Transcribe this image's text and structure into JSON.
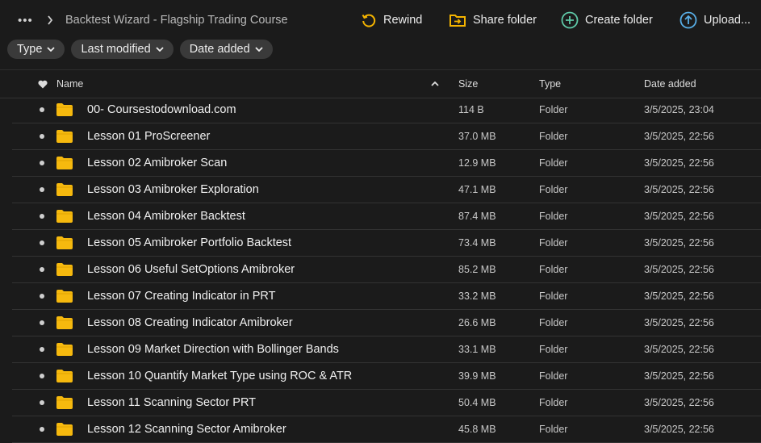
{
  "topbar": {
    "breadcrumb": "Backtest Wizard - Flagship Trading Course",
    "rewind_label": "Rewind",
    "share_label": "Share folder",
    "create_label": "Create folder",
    "upload_label": "Upload..."
  },
  "filters": {
    "type_label": "Type",
    "modified_label": "Last modified",
    "added_label": "Date added"
  },
  "columns": {
    "name": "Name",
    "size": "Size",
    "type": "Type",
    "date": "Date added"
  },
  "colors": {
    "accent_yellow": "#f5b400",
    "accent_teal": "#5fc9a8",
    "accent_blue": "#58aee6",
    "folder": "#f6b90e"
  },
  "files": [
    {
      "name": "00- Coursestodownload.com",
      "size": "114 B",
      "type": "Folder",
      "date": "3/5/2025, 23:04"
    },
    {
      "name": "Lesson 01 ProScreener",
      "size": "37.0 MB",
      "type": "Folder",
      "date": "3/5/2025, 22:56"
    },
    {
      "name": "Lesson 02 Amibroker Scan",
      "size": "12.9 MB",
      "type": "Folder",
      "date": "3/5/2025, 22:56"
    },
    {
      "name": "Lesson 03 Amibroker Exploration",
      "size": "47.1 MB",
      "type": "Folder",
      "date": "3/5/2025, 22:56"
    },
    {
      "name": "Lesson 04 Amibroker Backtest",
      "size": "87.4 MB",
      "type": "Folder",
      "date": "3/5/2025, 22:56"
    },
    {
      "name": "Lesson 05 Amibroker Portfolio Backtest",
      "size": "73.4 MB",
      "type": "Folder",
      "date": "3/5/2025, 22:56"
    },
    {
      "name": "Lesson 06 Useful SetOptions Amibroker",
      "size": "85.2 MB",
      "type": "Folder",
      "date": "3/5/2025, 22:56"
    },
    {
      "name": "Lesson 07 Creating Indicator in PRT",
      "size": "33.2 MB",
      "type": "Folder",
      "date": "3/5/2025, 22:56"
    },
    {
      "name": "Lesson 08 Creating Indicator Amibroker",
      "size": "26.6 MB",
      "type": "Folder",
      "date": "3/5/2025, 22:56"
    },
    {
      "name": "Lesson 09 Market Direction with Bollinger Bands",
      "size": "33.1 MB",
      "type": "Folder",
      "date": "3/5/2025, 22:56"
    },
    {
      "name": "Lesson 10 Quantify Market Type using ROC & ATR",
      "size": "39.9 MB",
      "type": "Folder",
      "date": "3/5/2025, 22:56"
    },
    {
      "name": "Lesson 11 Scanning Sector PRT",
      "size": "50.4 MB",
      "type": "Folder",
      "date": "3/5/2025, 22:56"
    },
    {
      "name": "Lesson 12 Scanning Sector Amibroker",
      "size": "45.8 MB",
      "type": "Folder",
      "date": "3/5/2025, 22:56"
    }
  ]
}
